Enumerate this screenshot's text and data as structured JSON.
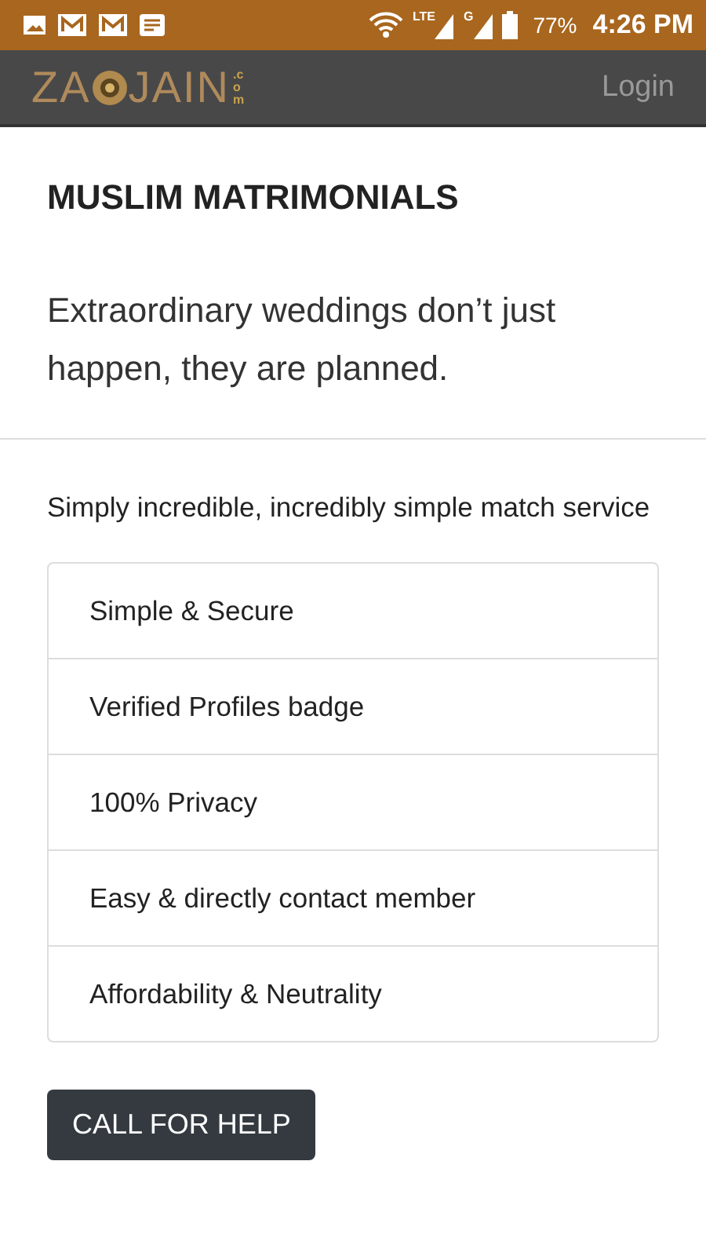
{
  "status_bar": {
    "network_1": "LTE",
    "network_2": "G",
    "battery": "77%",
    "time": "4:26 PM"
  },
  "navbar": {
    "logo_left": "ZA",
    "logo_right": "JAIN",
    "logo_suffix": ".com",
    "login": "Login"
  },
  "heading": "MUSLIM MATRIMONIALS",
  "lead": "Extraordinary weddings don’t just happen, they are planned.",
  "intro": "Simply incredible, incredibly simple match service",
  "features": [
    "Simple & Secure",
    "Verified Profiles badge",
    "100% Privacy",
    "Easy & directly contact member",
    "Affordability & Neutrality"
  ],
  "button": "CALL FOR HELP"
}
